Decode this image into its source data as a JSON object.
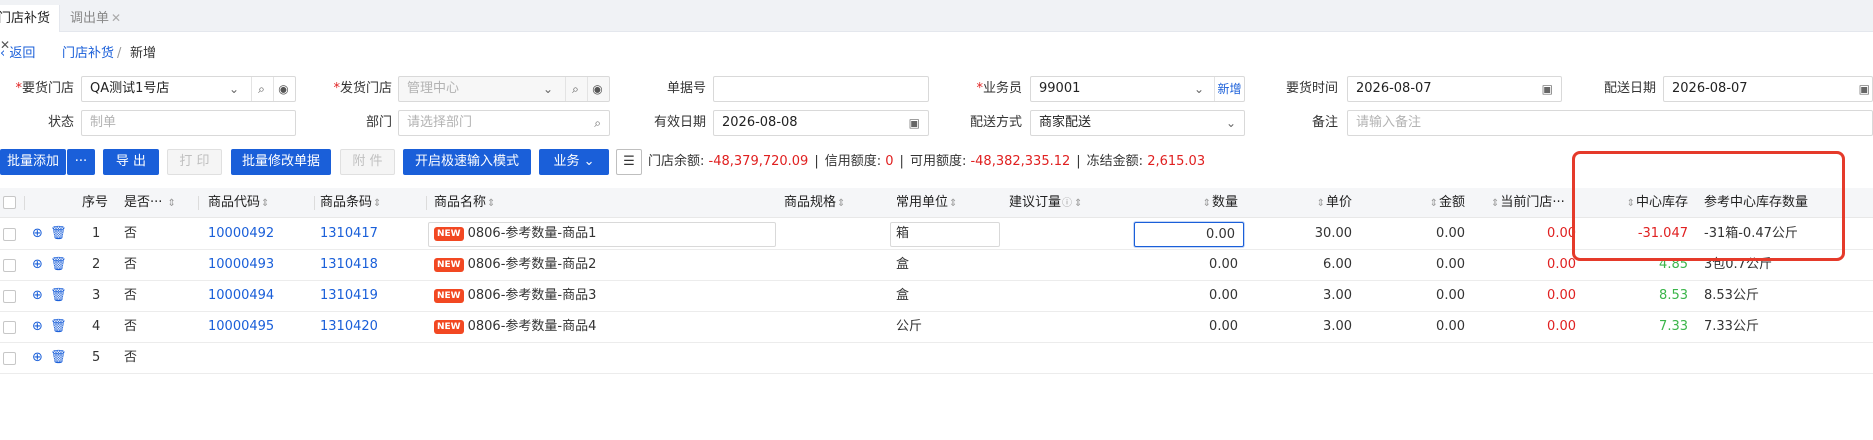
{
  "tabs": [
    {
      "label": "门店补货",
      "close": "✕"
    },
    {
      "label": "调出单",
      "close": "✕"
    }
  ],
  "breadcrumb": {
    "back": "返回",
    "parent": "门店补货",
    "separator": "/",
    "current": "新增"
  },
  "form": {
    "request_store": {
      "label": "要货门店",
      "value": "QA测试1号店"
    },
    "ship_store": {
      "label": "发货门店",
      "placeholder": "管理中心"
    },
    "doc_no": {
      "label": "单据号",
      "value": ""
    },
    "salesman": {
      "label": "业务员",
      "value": "99001",
      "add": "新增"
    },
    "request_time": {
      "label": "要货时间",
      "value": "2026-08-07"
    },
    "delivery_date": {
      "label": "配送日期",
      "value": "2026-08-07"
    },
    "status": {
      "label": "状态",
      "placeholder": "制单"
    },
    "department": {
      "label": "部门",
      "placeholder": "请选择部门"
    },
    "valid_date": {
      "label": "有效日期",
      "value": "2026-08-08"
    },
    "delivery_method": {
      "label": "配送方式",
      "value": "商家配送"
    },
    "remark": {
      "label": "备注",
      "placeholder": "请输入备注"
    }
  },
  "toolbar": {
    "batch_add": "批量添加",
    "more": "···",
    "export": "导 出",
    "print": "打 印",
    "batch_edit": "批量修改单据",
    "attachment": "附 件",
    "quick_input": "开启极速输入模式",
    "business": "业务"
  },
  "summary": {
    "store_balance_label": "门店余额:",
    "store_balance": "-48,379,720.09",
    "credit_label": "信用额度:",
    "credit": "0",
    "available_label": "可用额度:",
    "available": "-48,382,335.12",
    "frozen_label": "冻结金额:",
    "frozen": "2,615.03"
  },
  "table": {
    "headers": {
      "seq": "序号",
      "gift": "是否···",
      "code": "商品代码",
      "barcode": "商品条码",
      "name": "商品名称",
      "spec": "商品规格",
      "unit": "常用单位",
      "suggest": "建议订量",
      "qty": "数量",
      "price": "单价",
      "amount": "金额",
      "store_stock": "当前门店···",
      "center_stock": "中心库存",
      "ref_center_stock": "参考中心库存数量"
    },
    "rows": [
      {
        "seq": "1",
        "gift": "否",
        "code": "10000492",
        "barcode": "1310417",
        "badge": "NEW",
        "name": "0806-参考数量-商品1",
        "unit": "箱",
        "qty": "0.00",
        "price": "30.00",
        "amount": "0.00",
        "store_stock": "0.00",
        "center_stock": "-31.047",
        "ref_center_stock": "-31箱-0.47公斤"
      },
      {
        "seq": "2",
        "gift": "否",
        "code": "10000493",
        "barcode": "1310418",
        "badge": "NEW",
        "name": "0806-参考数量-商品2",
        "unit": "盒",
        "qty": "0.00",
        "price": "6.00",
        "amount": "0.00",
        "store_stock": "0.00",
        "center_stock": "4.85",
        "ref_center_stock": "3包0.7公斤"
      },
      {
        "seq": "3",
        "gift": "否",
        "code": "10000494",
        "barcode": "1310419",
        "badge": "NEW",
        "name": "0806-参考数量-商品3",
        "unit": "盒",
        "qty": "0.00",
        "price": "3.00",
        "amount": "0.00",
        "store_stock": "0.00",
        "center_stock": "8.53",
        "ref_center_stock": "8.53公斤"
      },
      {
        "seq": "4",
        "gift": "否",
        "code": "10000495",
        "barcode": "1310420",
        "badge": "NEW",
        "name": "0806-参考数量-商品4",
        "unit": "公斤",
        "qty": "0.00",
        "price": "3.00",
        "amount": "0.00",
        "store_stock": "0.00",
        "center_stock": "7.33",
        "ref_center_stock": "7.33公斤"
      },
      {
        "seq": "5",
        "gift": "否"
      }
    ]
  },
  "colors": {
    "primary": "#1a5fd9",
    "negative": "#e02020",
    "positive": "#3bb54a",
    "highlight": "#e53a2a"
  }
}
